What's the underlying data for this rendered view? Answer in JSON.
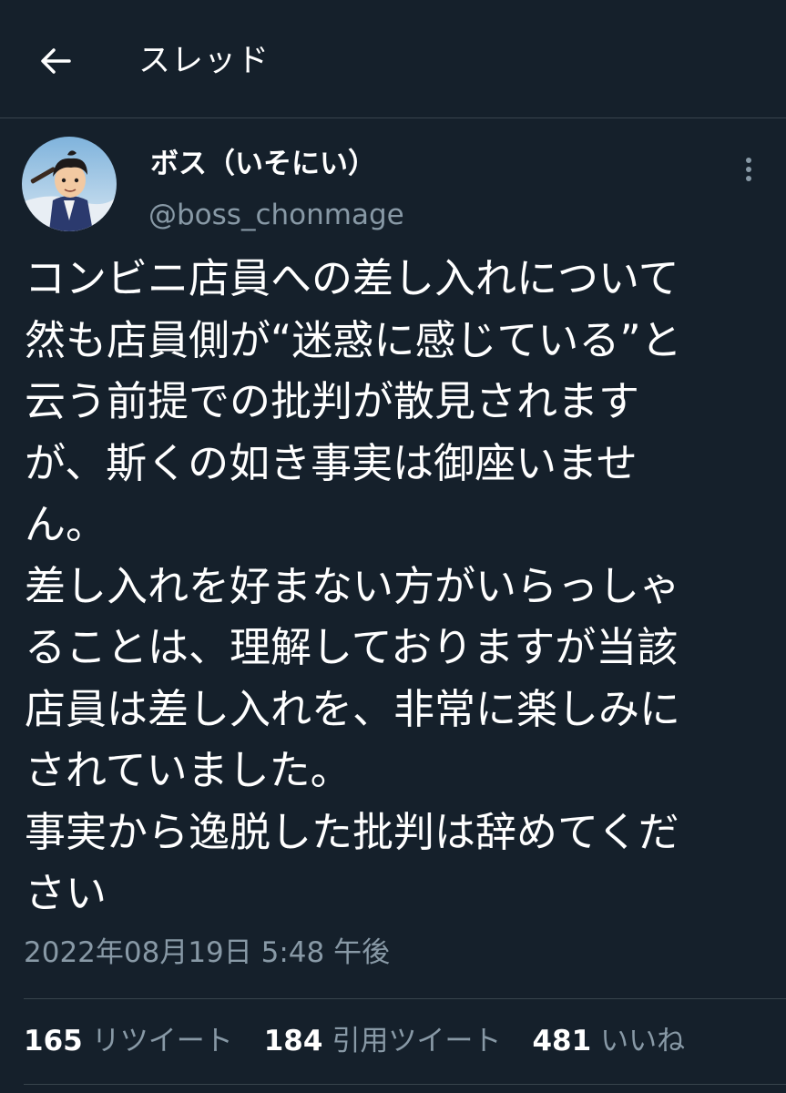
{
  "header": {
    "title": "スレッド",
    "back_icon": "arrow-left-icon"
  },
  "tweet": {
    "author": {
      "display_name": "ボス（いそにい）",
      "handle": "@boss_chonmage"
    },
    "more_icon": "more-vertical-icon",
    "text_lines": [
      "コンビニ店員への差し入れについて",
      "然も店員側が“迷惑に感じている”と",
      "云う前提での批判が散見されます",
      "が、斯くの如き事実は御座いませ",
      "ん。",
      "差し入れを好まない方がいらっしゃ",
      "ることは、理解しておりますが当該",
      "店員は差し入れを、非常に楽しみに",
      "されていました。",
      "事実から逸脱した批判は辞めてくだ",
      "さい"
    ],
    "timestamp": "2022年08月19日 5:48 午後",
    "stats": {
      "retweets": {
        "count": "165",
        "label": "リツイート"
      },
      "quotes": {
        "count": "184",
        "label": "引用ツイート"
      },
      "likes": {
        "count": "481",
        "label": "いいね"
      }
    }
  },
  "colors": {
    "background": "#15202b",
    "text": "#ffffff",
    "secondary_text": "#8899a6",
    "divider": "#38444d"
  }
}
